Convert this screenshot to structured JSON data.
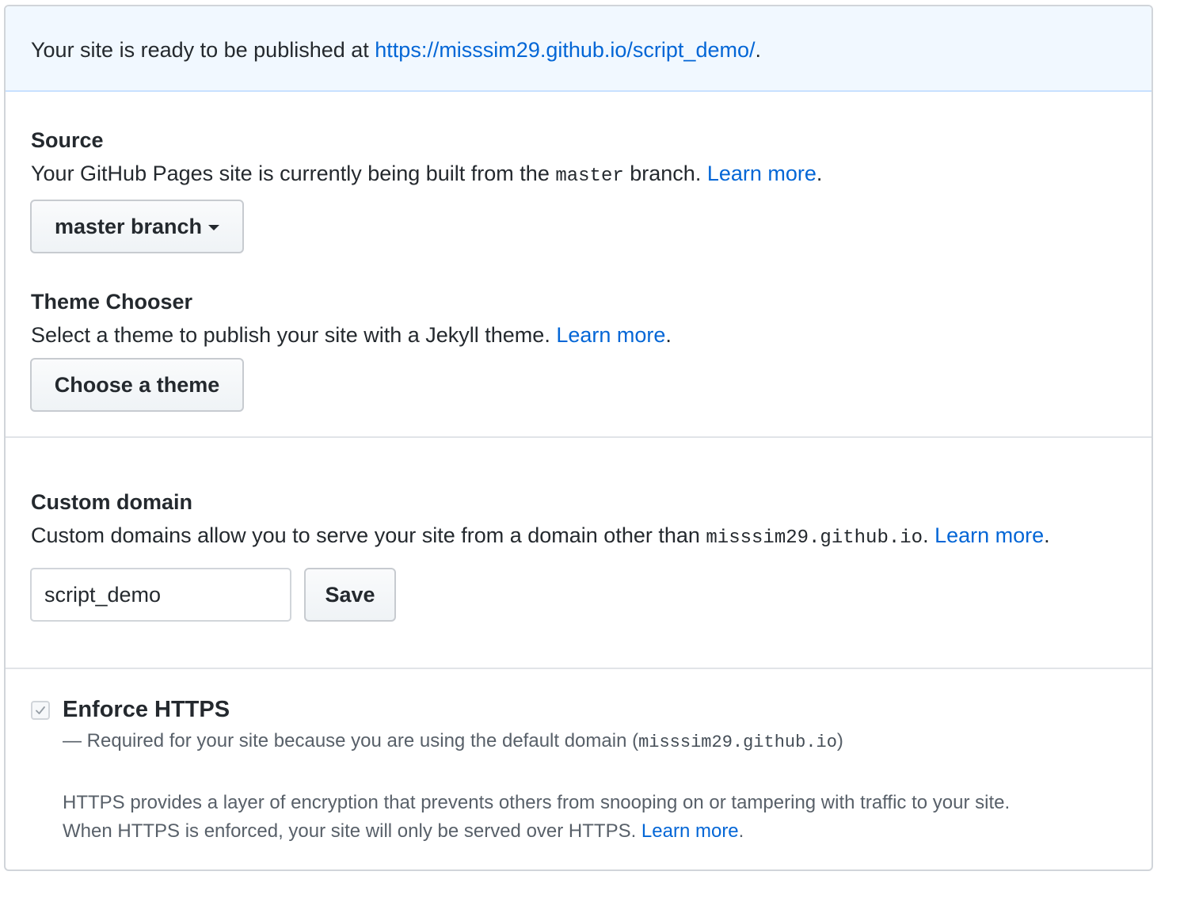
{
  "banner": {
    "prefix": "Your site is ready to be published at ",
    "url": "https://misssim29.github.io/script_demo/",
    "suffix": "."
  },
  "source": {
    "heading": "Source",
    "desc_prefix": "Your GitHub Pages site is currently being built from the ",
    "branch_code": "master",
    "desc_suffix": " branch. ",
    "learn_more": "Learn more",
    "period": ".",
    "select_label": "master branch"
  },
  "theme": {
    "heading": "Theme Chooser",
    "desc": "Select a theme to publish your site with a Jekyll theme. ",
    "learn_more": "Learn more",
    "period": ".",
    "button_label": "Choose a theme"
  },
  "custom_domain": {
    "heading": "Custom domain",
    "desc_prefix": "Custom domains allow you to serve your site from a domain other than ",
    "domain_code": "misssim29.github.io",
    "desc_suffix": ". ",
    "learn_more": "Learn more",
    "period": ".",
    "input_value": "script_demo",
    "save_label": "Save"
  },
  "https": {
    "checked": true,
    "title": "Enforce HTTPS",
    "required_prefix": "— Required for your site because you are using the default domain (",
    "required_domain": "misssim29.github.io",
    "required_suffix": ")",
    "info_line1": "HTTPS provides a layer of encryption that prevents others from snooping on or tampering with traffic to your site.",
    "info_line2": "When HTTPS is enforced, your site will only be served over HTTPS. ",
    "learn_more": "Learn more",
    "period": "."
  },
  "colors": {
    "link": "#0366d6",
    "banner_bg": "#f1f8ff",
    "border": "#d1d5da",
    "text": "#24292e",
    "muted": "#586069"
  }
}
